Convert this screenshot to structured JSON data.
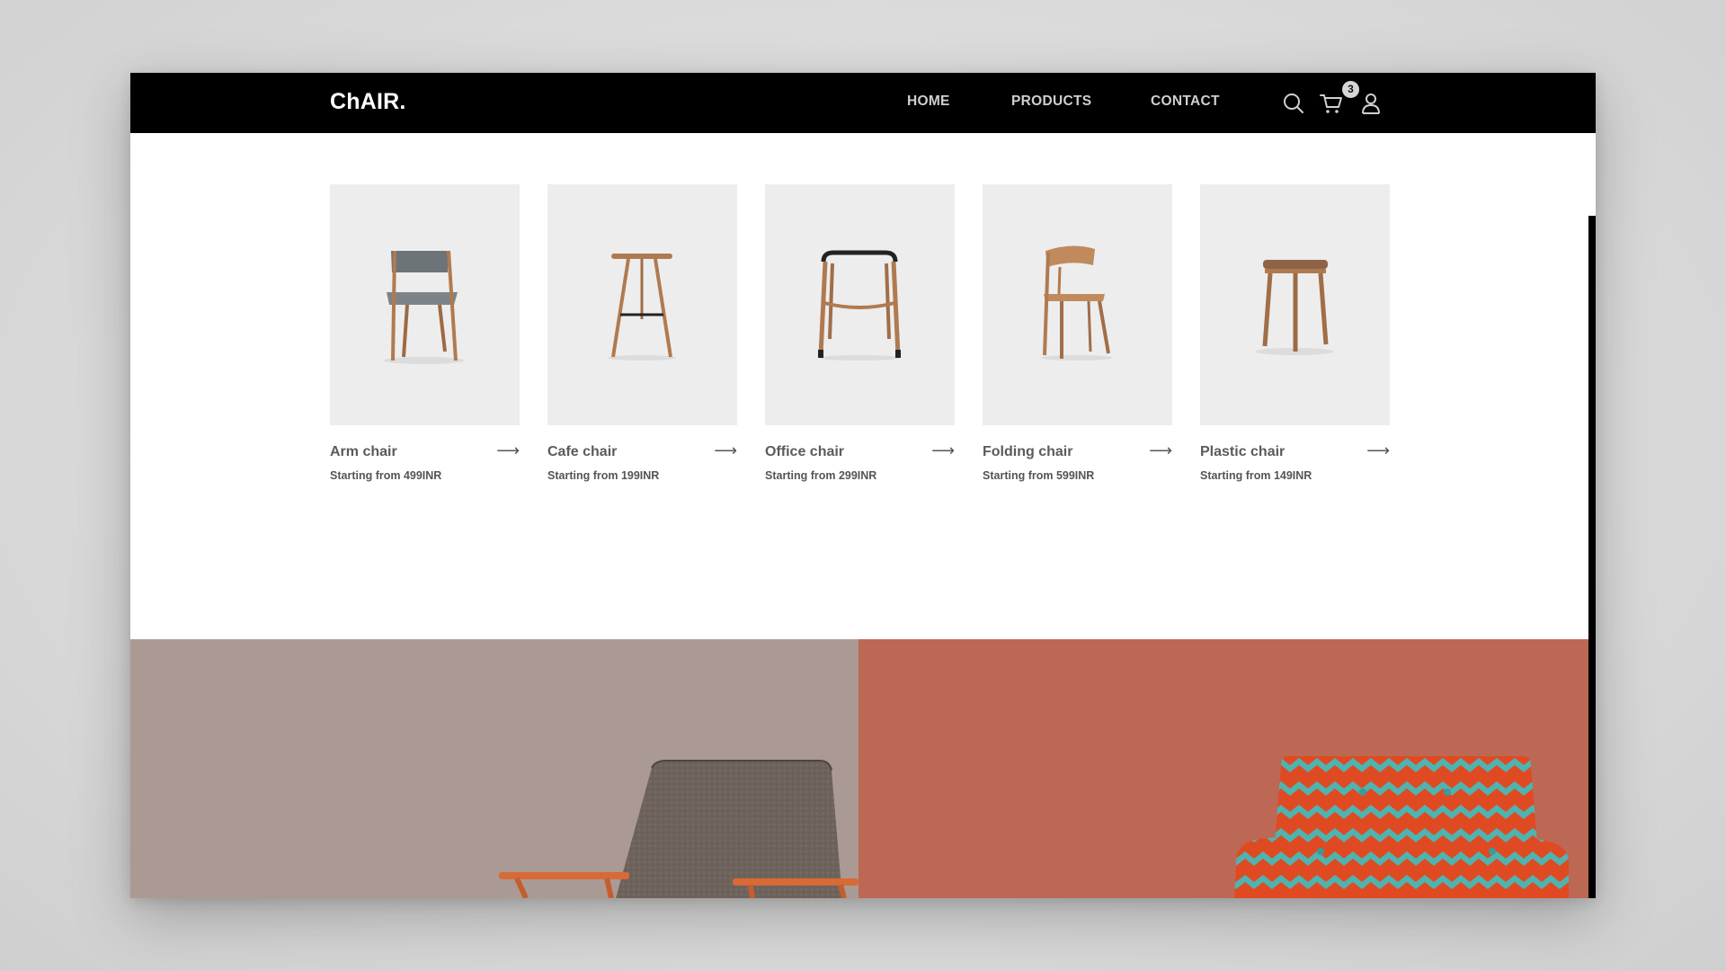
{
  "brand": {
    "logo": "ChAIR."
  },
  "nav": {
    "links": [
      "HOME",
      "PRODUCTS",
      "CONTACT"
    ],
    "icons": [
      "search-icon",
      "cart-icon",
      "user-icon"
    ],
    "cart_count": "3"
  },
  "products": [
    {
      "name": "Arm chair",
      "price": "Starting from 499INR"
    },
    {
      "name": "Cafe chair",
      "price": "Starting from 199INR"
    },
    {
      "name": "Office chair",
      "price": "Starting from 299INR"
    },
    {
      "name": "Folding chair",
      "price": "Starting from 599INR"
    },
    {
      "name": "Plastic chair",
      "price": "Starting from 149INR"
    }
  ],
  "card_arrow": "⟶",
  "colors": {
    "navbar": "#000000",
    "card_bg": "#ededed",
    "banner_left": "#ab9a93",
    "banner_right": "#bd6855",
    "pattern_teal": "#4fb3b0",
    "pattern_orange": "#e04a22",
    "wood": "#b07a50"
  }
}
